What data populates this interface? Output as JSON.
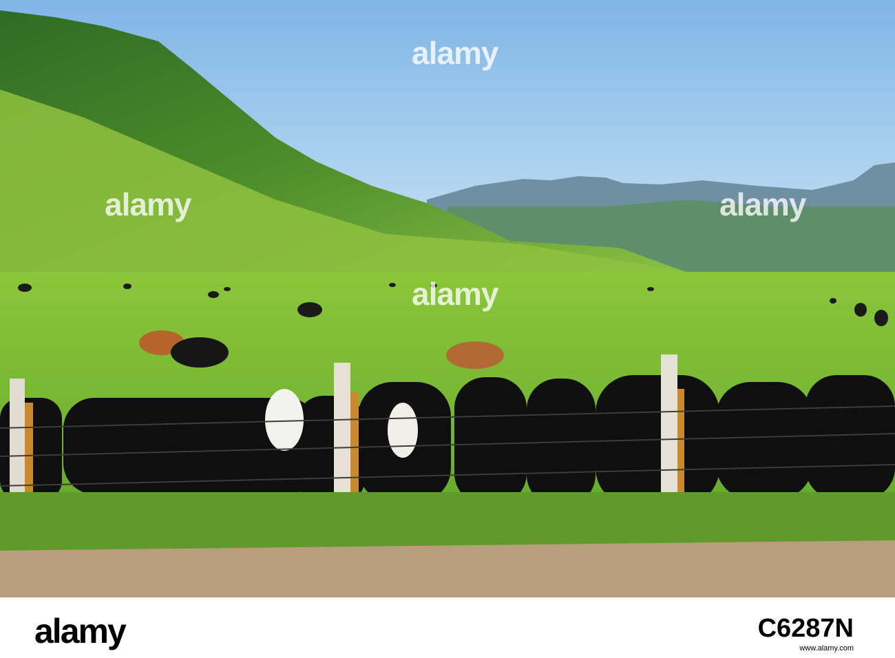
{
  "photo": {
    "description_icon": "pasture-with-cattle-and-fence",
    "watermarks": [
      "alamy",
      "alamy",
      "alamy",
      "alamy"
    ]
  },
  "footer": {
    "brand": "alamy",
    "image_id": "C6287N",
    "site": "www.alamy.com"
  }
}
